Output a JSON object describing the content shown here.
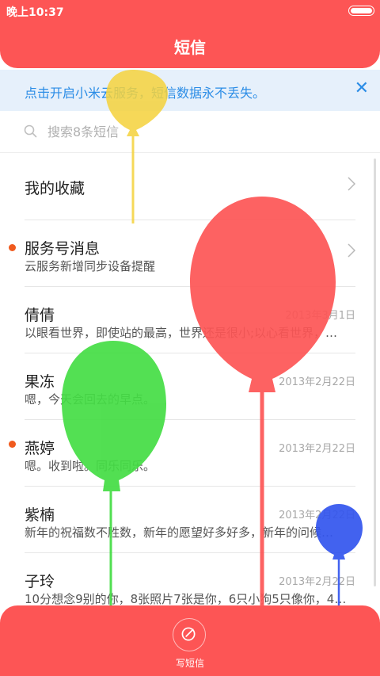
{
  "status_bar": {
    "time": "晚上10:37"
  },
  "header": {
    "title": "短信"
  },
  "banner": {
    "text": "点击开启小米云服务，短信数据永不丢失。",
    "close_icon": "close-icon"
  },
  "search": {
    "placeholder": "搜索8条短信",
    "icon": "search-icon"
  },
  "list": [
    {
      "name": "我的收藏",
      "preview": "",
      "date": "",
      "unread": false,
      "chevron": true
    },
    {
      "name": "服务号消息",
      "preview": "云服务新增同步设备提醒",
      "date": "",
      "unread": true,
      "chevron": true
    },
    {
      "name": "倩倩",
      "preview": "以眼看世界，即使站的最高，世界还是很小;以心看世界，…",
      "date": "2013年3月1日",
      "unread": false
    },
    {
      "name": "果冻",
      "preview": "嗯，今天会回去的早点。",
      "date": "2013年2月22日",
      "unread": false
    },
    {
      "name": "燕婷",
      "preview": "嗯。收到啦。同乐同乐。",
      "date": "2013年2月22日",
      "unread": true
    },
    {
      "name": "紫楠",
      "preview": "新年的祝福数不胜数，新年的愿望好多好多，新年的问候…",
      "date": "2013年2月22日",
      "unread": false
    },
    {
      "name": "子玲",
      "preview": "10分想念9别的你，8张照片7张是你，6只小狗5只像你，4…",
      "date": "2013年2月22日",
      "unread": false
    }
  ],
  "compose": {
    "label": "写短信",
    "icon": "compose-icon"
  },
  "colors": {
    "accent": "#fd5555",
    "banner_text": "#2a8ce6",
    "unread_dot": "#f05a1e",
    "balloon_yellow": "#f5d23c",
    "balloon_red": "#fd5555",
    "balloon_green": "#44dd44",
    "balloon_blue": "#3355ee"
  }
}
